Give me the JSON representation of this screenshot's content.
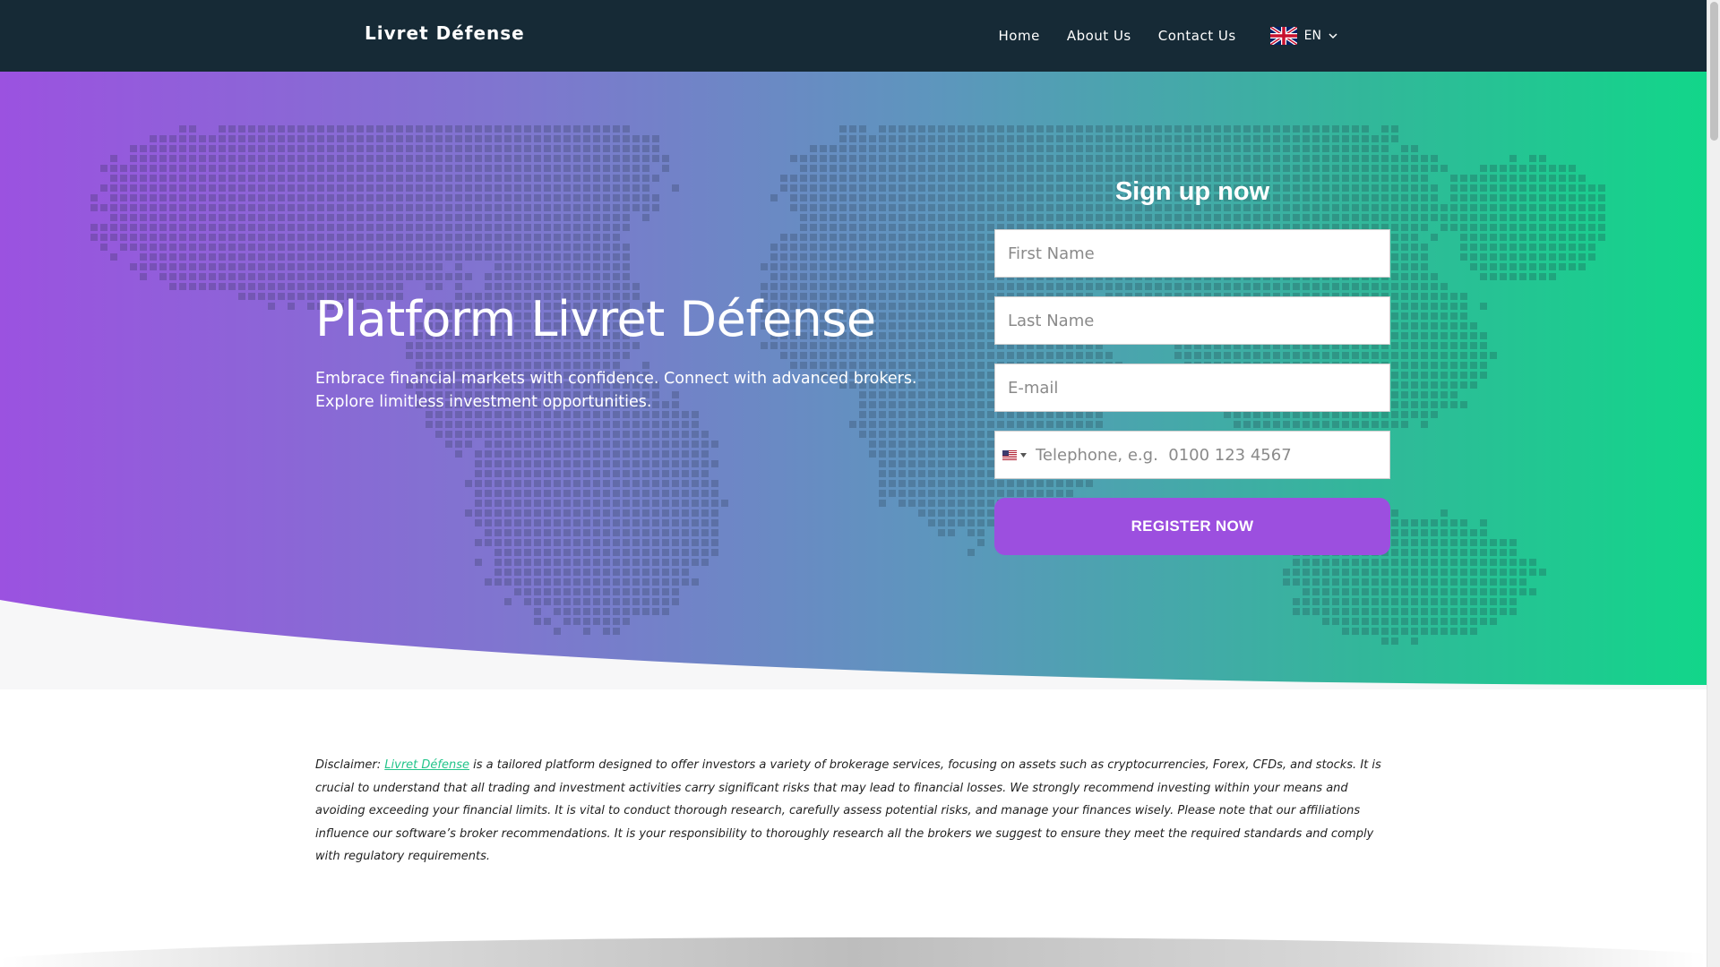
{
  "header": {
    "brand": "Livret Défense",
    "nav": [
      "Home",
      "About Us",
      "Contact Us"
    ],
    "language": "EN"
  },
  "hero": {
    "title": "Platform Livret Défense",
    "subtitle": "Embrace financial markets with confidence. Connect with advanced brokers. Explore limitless investment opportunities."
  },
  "signup": {
    "title": "Sign up now",
    "first_name_placeholder": "First Name",
    "last_name_placeholder": "Last Name",
    "email_placeholder": "E-mail",
    "phone_placeholder": "Telephone, e.g.  0100 123 4567",
    "register_label": "REGISTER NOW"
  },
  "disclaimer": {
    "prefix": "Disclaimer: ",
    "link_text": "Livret Défense",
    "body": " is a tailored platform designed to offer investors a variety of brokerage services, focusing on assets such as cryptocurrencies, Forex, CFDs, and stocks. It is crucial to understand that all trading and investment activities carry significant risks that may lead to financial losses. We strongly recommend investing within your means and avoiding exceeding your financial limits. It is vital to conduct thorough research, carefully assess potential risks, and manage your finances wisely. Please note that our affiliations influence our software’s broker recommendations. It is your responsibility to thoroughly research all the brokers we suggest to ensure they meet the required standards and comply with regulatory requirements."
  },
  "colors": {
    "header_bg": "#162a36",
    "gradient_start": "#9b52e0",
    "gradient_end": "#12d68a",
    "button": "#9c4fdf",
    "link": "#22c48a"
  },
  "icons": {
    "language_flag": "uk-flag-icon",
    "language_chevron": "chevron-down-icon",
    "phone_flag": "us-flag-icon"
  }
}
